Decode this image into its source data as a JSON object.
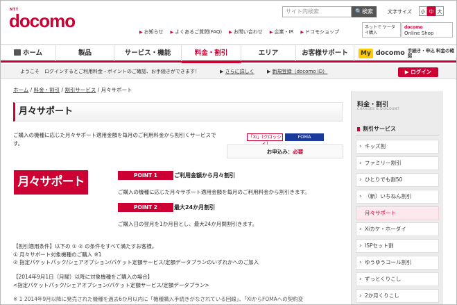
{
  "header": {
    "logo_ntt": "NTT",
    "logo": "docomo",
    "search_placeholder": "サイト内検索",
    "search_button": "検索",
    "font_size_label": "文字サイズ",
    "font_sizes": [
      "小",
      "中",
      "大"
    ],
    "util_links": [
      "お知らせ",
      "よくあるご質問(FAQ)",
      "お問い合わせ",
      "企業・IR",
      "ドコモショップ"
    ],
    "pc_banner": "ネットで ケータイ購入",
    "shop_banner_brand": "docomo",
    "shop_banner": "Online Shop"
  },
  "nav": {
    "items": [
      "ホーム",
      "製品",
      "サービス・機能",
      "料金・割引",
      "エリア",
      "お客様サポート"
    ],
    "mydocomo_badge": "My",
    "mydocomo_label": "docomo",
    "mydocomo_sub": "手続き・申込 料金の確認"
  },
  "welcome": {
    "greeting": "ようこそ　ログインするとご利用料金・ポイントのご確認、お手続きができます！",
    "more": "さらに詳しく",
    "signup": "新規登録（docomo ID）",
    "login": "ログイン"
  },
  "breadcrumb": [
    "ホーム",
    "料金・割引",
    "割引サービス",
    "月々サポート"
  ],
  "page": {
    "title": "月々サポート",
    "intro": "ご購入の機種に応じた月々サポート適用金額を毎月のご利用料金から割引くサービスです。",
    "tag_xi": "「Xi」(クロッシィ)",
    "tag_foma": "FOMA",
    "apply_label": "お申込み：",
    "apply_value": "必要",
    "logo_card": "月々サポート",
    "points": [
      {
        "badge": "POINT 1",
        "title": "ご利用金額から月々割引",
        "desc": "ご購入の機種に応じた月々サポート適用金額を毎月のご利用料金から割引きます。"
      },
      {
        "badge": "POINT 2",
        "title": "最大24か月割引",
        "desc": "ご購入日の翌月を1か月目とし、最大24か月間割引きます。"
      }
    ],
    "conditions": [
      "【割引適用条件】以下の ① ② の条件をすべて満たすお客様。",
      "① 月々サポート対象機種のご購入 ※1",
      "② 指定パケットパック/シェアオプション/パケット定額サービス/定額データプランのいずれかへのご加入",
      "【2014年9月1日（月曜）以降に対象機種をご購入の場合】",
      "<指定パケットパック/シェアオプション/パケット定額サービス/定額データプラン>",
      "※ 1 2014年9月以降に発売された機種を過去6か月以内に「機種購入手続きがなされている回線」、「XiからFOMAへの契約変"
    ]
  },
  "sidebar": {
    "heading": "料金・割引",
    "heading_sub": "CHARGES & DISCOUNT",
    "section": "割引サービス",
    "items": [
      "キッズ割",
      "ファミリー割引",
      "ひとりでも割50",
      "（新）いちねん割引",
      "月々サポート",
      "Xiカケ・ホーダイ",
      "ISPセット割",
      "ゆうゆうコール割引",
      "ずっとくりこし",
      "2か月くりこし"
    ],
    "current_index": 4
  },
  "colors": {
    "brand": "#cc0033",
    "foma": "#1a3b9c",
    "mydocomo": "#ffcc00"
  }
}
